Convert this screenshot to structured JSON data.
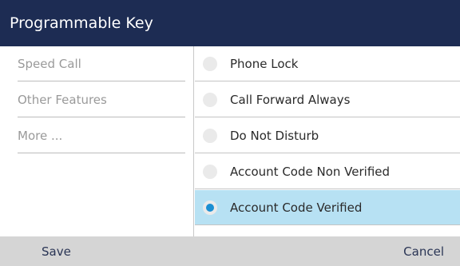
{
  "header": {
    "title": "Programmable Key"
  },
  "left_menu": {
    "items": [
      {
        "label": "Speed Call"
      },
      {
        "label": "Other Features"
      },
      {
        "label": "More ..."
      }
    ]
  },
  "options": {
    "items": [
      {
        "label": "Phone Lock",
        "selected": false
      },
      {
        "label": "Call Forward Always",
        "selected": false
      },
      {
        "label": "Do Not Disturb",
        "selected": false
      },
      {
        "label": "Account Code Non Verified",
        "selected": false
      },
      {
        "label": "Account Code Verified",
        "selected": true
      }
    ]
  },
  "softkeys": {
    "save_label": "Save",
    "cancel_label": "Cancel"
  },
  "colors": {
    "title_bar": "#1d2c53",
    "selected_row": "#b7e1f3",
    "radio_selected": "#1b8fd2",
    "footer": "#d5d5d5"
  }
}
